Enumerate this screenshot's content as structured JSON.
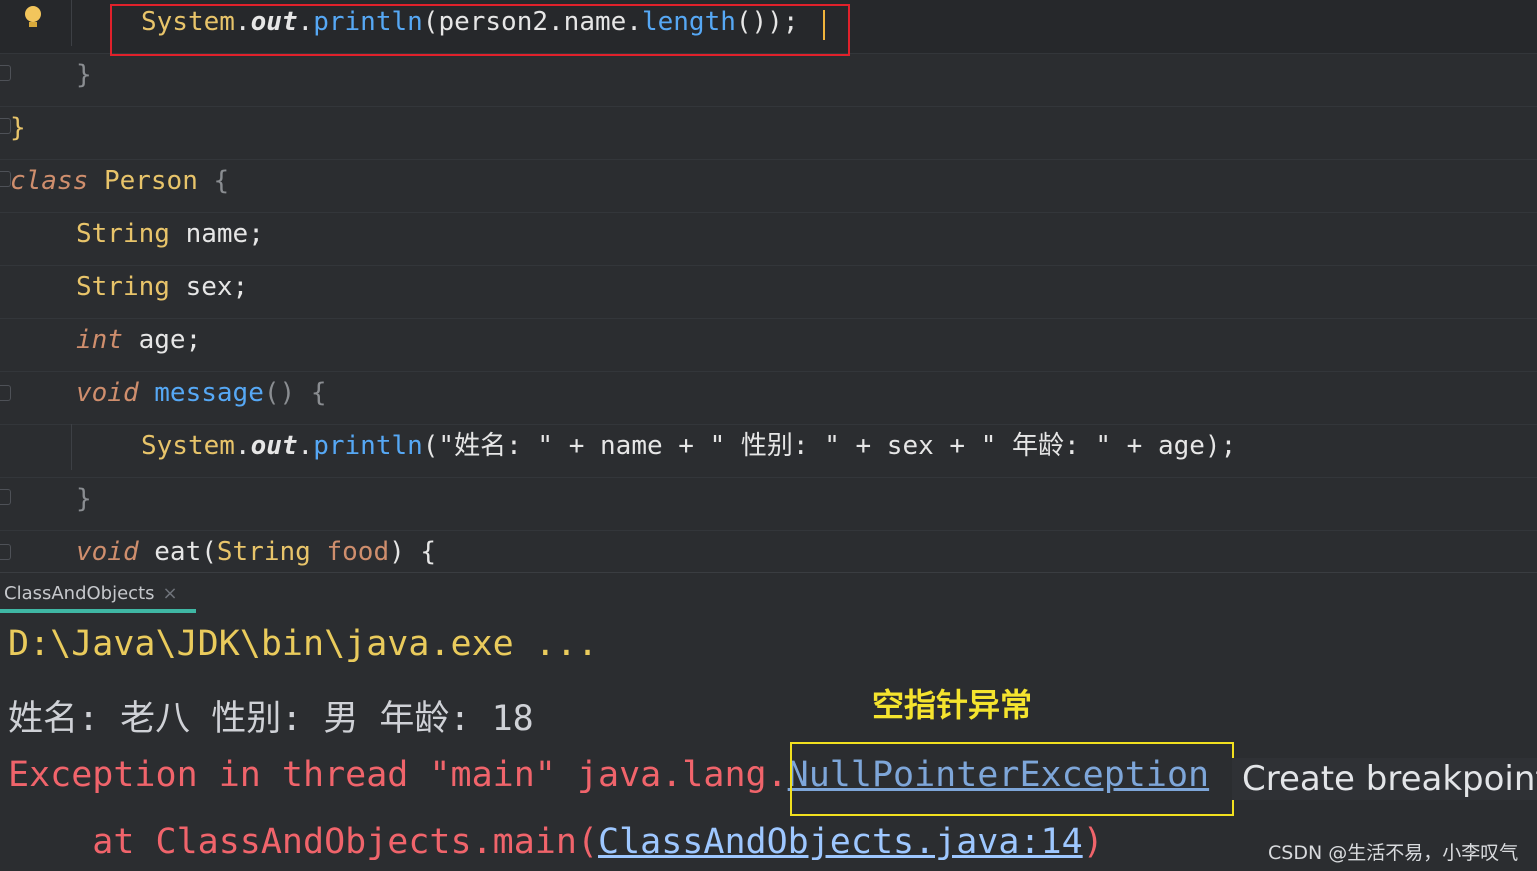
{
  "editor": {
    "lines": {
      "l1": {
        "system": "System",
        "dot1": ".",
        "out": "out",
        "dot2": ".",
        "println": "println",
        "open": "(",
        "person2": "person2",
        "dot3": ".",
        "name": "name",
        "dot4": ".",
        "length": "length",
        "close": "());"
      },
      "l2": {
        "brace": "}"
      },
      "l3": {
        "brace": "}"
      },
      "l4": {
        "kw": "class",
        "name": "Person",
        "brace": "{"
      },
      "l5": {
        "type": "String",
        "name": "name;"
      },
      "l6": {
        "type": "String",
        "name": "sex;"
      },
      "l7": {
        "type": "int",
        "name": "age;"
      },
      "l8": {
        "kw": "void",
        "method": "message",
        "rest": "() {"
      },
      "l9": {
        "system": "System",
        "dot1": ".",
        "out": "out",
        "dot2": ".",
        "println": "println",
        "args": "(\"姓名: \" + name + \" 性别: \" + sex + \" 年龄: \" + age);"
      },
      "l10": {
        "brace": "}"
      },
      "l11": {
        "kw": "void",
        "method": "eat",
        "open": "(",
        "type": "String",
        "param": "food",
        "rest": ") {"
      }
    }
  },
  "tab": {
    "label": "ClassAndObjects",
    "close": "×"
  },
  "console": {
    "line1": "D:\\Java\\JDK\\bin\\java.exe ...",
    "line2": "姓名: 老八 性别: 男 年龄: 18",
    "line3_prefix": "Exception in thread \"main\" java.lang.",
    "line3_link": "NullPointerException",
    "line4_prefix": "    at ClassAndObjects.main(",
    "line4_link": "ClassAndObjects.java:14",
    "line4_suffix": ")"
  },
  "annotation": "空指针异常",
  "breakpoint_popup": "Create breakpoint",
  "watermark": "CSDN @生活不易，小李叹气",
  "colors": {
    "highlight_red": "#e0212b",
    "highlight_yellow": "#f1e01f",
    "tab_accent": "#3fb7a4"
  }
}
